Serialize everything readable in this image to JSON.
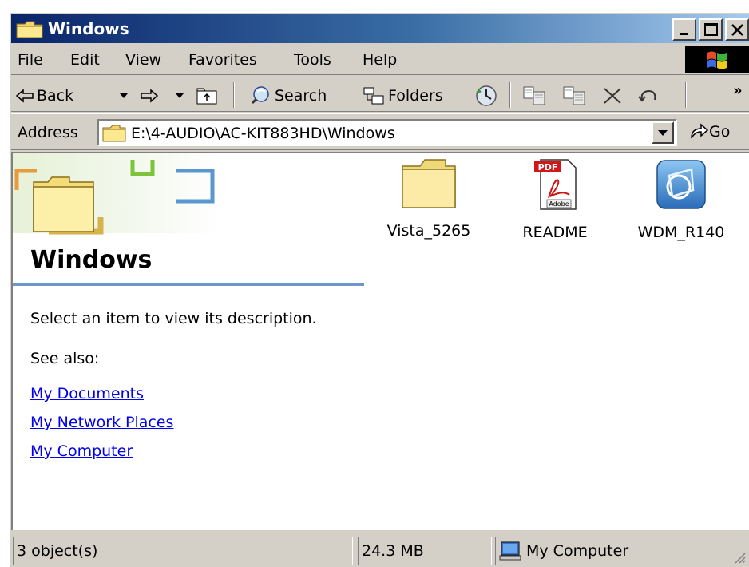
{
  "window": {
    "title": "Windows"
  },
  "menu": {
    "items": [
      {
        "label": "File"
      },
      {
        "label": "Edit"
      },
      {
        "label": "View"
      },
      {
        "label": "Favorites"
      },
      {
        "label": "Tools"
      },
      {
        "label": "Help"
      }
    ]
  },
  "toolbar": {
    "back_label": "Back",
    "search_label": "Search",
    "folders_label": "Folders"
  },
  "address": {
    "label": "Address",
    "value": "E:\\4-AUDIO\\AC-KIT883HD\\Windows",
    "go_label": "Go"
  },
  "panel": {
    "folder_name": "Windows",
    "description": "Select an item to view its description.",
    "see_also": "See also:",
    "links": [
      "My Documents",
      "My Network Places",
      "My Computer"
    ]
  },
  "files": [
    {
      "name": "Vista_5265",
      "icon": "folder-icon"
    },
    {
      "name": "README",
      "icon": "pdf-icon"
    },
    {
      "name": "WDM_R140",
      "icon": "setup-icon"
    }
  ],
  "status": {
    "objects": "3 object(s)",
    "size": "24.3 MB",
    "zone": "My Computer"
  },
  "colors": {
    "title_start": "#0a246a",
    "title_end": "#a6caf0",
    "face": "#d4d0c8",
    "link": "#0000ee",
    "rule": "#6d97c8"
  }
}
